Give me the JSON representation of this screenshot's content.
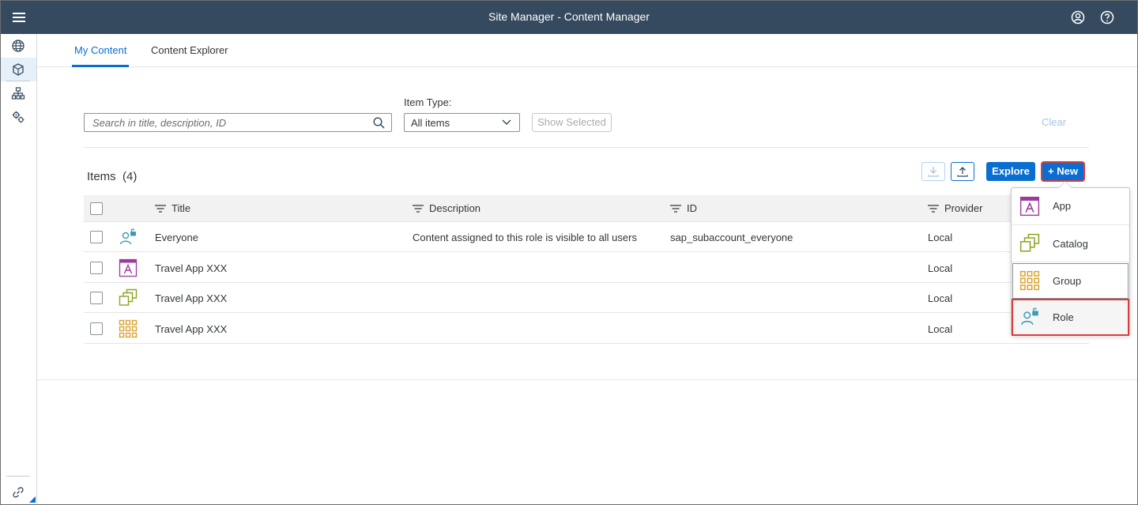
{
  "shell": {
    "title": "Site Manager - Content Manager",
    "icons": [
      "menu-icon",
      "user-icon",
      "help-icon"
    ]
  },
  "sidenav": {
    "items": [
      {
        "icon": "globe-icon",
        "active": false
      },
      {
        "icon": "cube-icon",
        "active": true
      },
      {
        "icon": "hierarchy-icon",
        "active": false
      },
      {
        "icon": "settings-icon",
        "active": false
      }
    ],
    "footer_icon": "link-icon"
  },
  "tabs": [
    {
      "label": "My Content",
      "active": true
    },
    {
      "label": "Content Explorer",
      "active": false
    }
  ],
  "filters": {
    "search_placeholder": "Search in title, description, ID",
    "item_type_label": "Item Type:",
    "item_type_value": "All items",
    "show_selected": "Show Selected",
    "clear": "Clear"
  },
  "table": {
    "title": "Items",
    "count": "(4)",
    "columns": [
      "Title",
      "Description",
      "ID",
      "Provider"
    ],
    "rows": [
      {
        "icon": "role-icon",
        "title": "Everyone",
        "description": "Content assigned to this role is visible to all users",
        "id": "sap_subaccount_everyone",
        "provider": "Local"
      },
      {
        "icon": "app-icon",
        "title": "Travel App XXX",
        "description": "",
        "id": "",
        "provider": "Local"
      },
      {
        "icon": "catalog-icon",
        "title": "Travel App XXX",
        "description": "",
        "id": "",
        "provider": "Local"
      },
      {
        "icon": "group-icon",
        "title": "Travel App XXX",
        "description": "",
        "id": "",
        "provider": "Local"
      }
    ]
  },
  "toolbar": {
    "download_icon": "download-icon",
    "upload_icon": "upload-icon",
    "explore": "Explore",
    "new": "+ New"
  },
  "new_menu": {
    "items": [
      {
        "label": "App",
        "icon": "app-icon"
      },
      {
        "label": "Catalog",
        "icon": "catalog-icon"
      },
      {
        "label": "Group",
        "icon": "group-icon"
      },
      {
        "label": "Role",
        "icon": "role-icon"
      }
    ]
  },
  "colors": {
    "shell_bg": "#354a5f",
    "accent": "#0a6ed1",
    "highlight": "#e03b3b",
    "app_purple": "#9b3b9b",
    "catalog_green": "#8aa51f",
    "group_gold": "#d9a334",
    "role_teal": "#3f9bb1"
  }
}
